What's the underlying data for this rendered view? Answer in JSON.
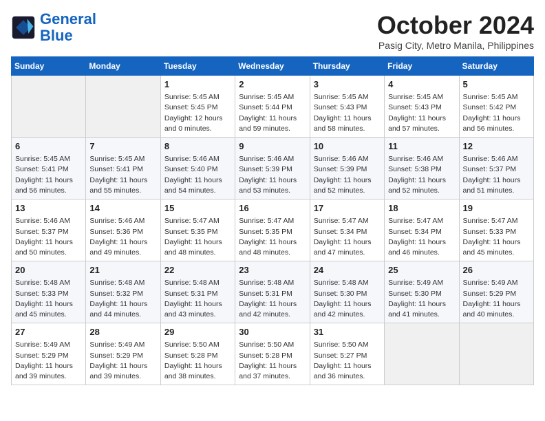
{
  "logo": {
    "line1": "General",
    "line2": "Blue"
  },
  "title": "October 2024",
  "subtitle": "Pasig City, Metro Manila, Philippines",
  "days_header": [
    "Sunday",
    "Monday",
    "Tuesday",
    "Wednesday",
    "Thursday",
    "Friday",
    "Saturday"
  ],
  "weeks": [
    [
      {
        "day": "",
        "content": ""
      },
      {
        "day": "",
        "content": ""
      },
      {
        "day": "1",
        "content": "Sunrise: 5:45 AM\nSunset: 5:45 PM\nDaylight: 12 hours\nand 0 minutes."
      },
      {
        "day": "2",
        "content": "Sunrise: 5:45 AM\nSunset: 5:44 PM\nDaylight: 11 hours\nand 59 minutes."
      },
      {
        "day": "3",
        "content": "Sunrise: 5:45 AM\nSunset: 5:43 PM\nDaylight: 11 hours\nand 58 minutes."
      },
      {
        "day": "4",
        "content": "Sunrise: 5:45 AM\nSunset: 5:43 PM\nDaylight: 11 hours\nand 57 minutes."
      },
      {
        "day": "5",
        "content": "Sunrise: 5:45 AM\nSunset: 5:42 PM\nDaylight: 11 hours\nand 56 minutes."
      }
    ],
    [
      {
        "day": "6",
        "content": "Sunrise: 5:45 AM\nSunset: 5:41 PM\nDaylight: 11 hours\nand 56 minutes."
      },
      {
        "day": "7",
        "content": "Sunrise: 5:45 AM\nSunset: 5:41 PM\nDaylight: 11 hours\nand 55 minutes."
      },
      {
        "day": "8",
        "content": "Sunrise: 5:46 AM\nSunset: 5:40 PM\nDaylight: 11 hours\nand 54 minutes."
      },
      {
        "day": "9",
        "content": "Sunrise: 5:46 AM\nSunset: 5:39 PM\nDaylight: 11 hours\nand 53 minutes."
      },
      {
        "day": "10",
        "content": "Sunrise: 5:46 AM\nSunset: 5:39 PM\nDaylight: 11 hours\nand 52 minutes."
      },
      {
        "day": "11",
        "content": "Sunrise: 5:46 AM\nSunset: 5:38 PM\nDaylight: 11 hours\nand 52 minutes."
      },
      {
        "day": "12",
        "content": "Sunrise: 5:46 AM\nSunset: 5:37 PM\nDaylight: 11 hours\nand 51 minutes."
      }
    ],
    [
      {
        "day": "13",
        "content": "Sunrise: 5:46 AM\nSunset: 5:37 PM\nDaylight: 11 hours\nand 50 minutes."
      },
      {
        "day": "14",
        "content": "Sunrise: 5:46 AM\nSunset: 5:36 PM\nDaylight: 11 hours\nand 49 minutes."
      },
      {
        "day": "15",
        "content": "Sunrise: 5:47 AM\nSunset: 5:35 PM\nDaylight: 11 hours\nand 48 minutes."
      },
      {
        "day": "16",
        "content": "Sunrise: 5:47 AM\nSunset: 5:35 PM\nDaylight: 11 hours\nand 48 minutes."
      },
      {
        "day": "17",
        "content": "Sunrise: 5:47 AM\nSunset: 5:34 PM\nDaylight: 11 hours\nand 47 minutes."
      },
      {
        "day": "18",
        "content": "Sunrise: 5:47 AM\nSunset: 5:34 PM\nDaylight: 11 hours\nand 46 minutes."
      },
      {
        "day": "19",
        "content": "Sunrise: 5:47 AM\nSunset: 5:33 PM\nDaylight: 11 hours\nand 45 minutes."
      }
    ],
    [
      {
        "day": "20",
        "content": "Sunrise: 5:48 AM\nSunset: 5:33 PM\nDaylight: 11 hours\nand 45 minutes."
      },
      {
        "day": "21",
        "content": "Sunrise: 5:48 AM\nSunset: 5:32 PM\nDaylight: 11 hours\nand 44 minutes."
      },
      {
        "day": "22",
        "content": "Sunrise: 5:48 AM\nSunset: 5:31 PM\nDaylight: 11 hours\nand 43 minutes."
      },
      {
        "day": "23",
        "content": "Sunrise: 5:48 AM\nSunset: 5:31 PM\nDaylight: 11 hours\nand 42 minutes."
      },
      {
        "day": "24",
        "content": "Sunrise: 5:48 AM\nSunset: 5:30 PM\nDaylight: 11 hours\nand 42 minutes."
      },
      {
        "day": "25",
        "content": "Sunrise: 5:49 AM\nSunset: 5:30 PM\nDaylight: 11 hours\nand 41 minutes."
      },
      {
        "day": "26",
        "content": "Sunrise: 5:49 AM\nSunset: 5:29 PM\nDaylight: 11 hours\nand 40 minutes."
      }
    ],
    [
      {
        "day": "27",
        "content": "Sunrise: 5:49 AM\nSunset: 5:29 PM\nDaylight: 11 hours\nand 39 minutes."
      },
      {
        "day": "28",
        "content": "Sunrise: 5:49 AM\nSunset: 5:29 PM\nDaylight: 11 hours\nand 39 minutes."
      },
      {
        "day": "29",
        "content": "Sunrise: 5:50 AM\nSunset: 5:28 PM\nDaylight: 11 hours\nand 38 minutes."
      },
      {
        "day": "30",
        "content": "Sunrise: 5:50 AM\nSunset: 5:28 PM\nDaylight: 11 hours\nand 37 minutes."
      },
      {
        "day": "31",
        "content": "Sunrise: 5:50 AM\nSunset: 5:27 PM\nDaylight: 11 hours\nand 36 minutes."
      },
      {
        "day": "",
        "content": ""
      },
      {
        "day": "",
        "content": ""
      }
    ]
  ]
}
